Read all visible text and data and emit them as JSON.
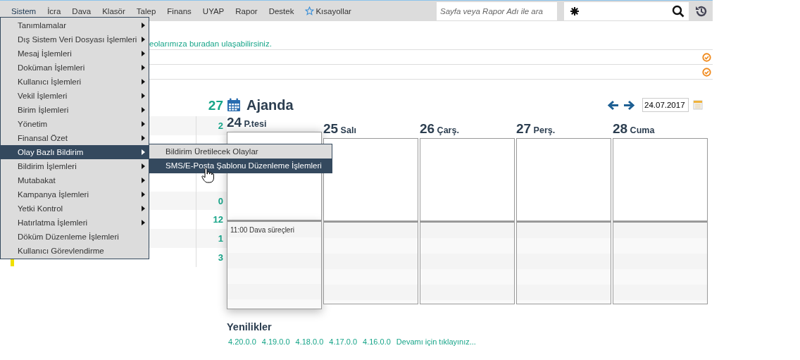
{
  "menubar": {
    "items": [
      {
        "label": "Sistem",
        "selected": true
      },
      {
        "label": "İcra",
        "selected": false
      },
      {
        "label": "Dava",
        "selected": false
      },
      {
        "label": "Klasör",
        "selected": false
      },
      {
        "label": "Talep",
        "selected": false
      },
      {
        "label": "Finans",
        "selected": false
      },
      {
        "label": "UYAP",
        "selected": false
      },
      {
        "label": "Rapor",
        "selected": false
      },
      {
        "label": "Destek",
        "selected": false
      }
    ],
    "shortcuts": "Kısayollar",
    "search": {
      "placeholder": "Sayfa veya Rapor Adı ile ara"
    }
  },
  "notice": "eolarımıza buradan ulaşabilirsiniz.",
  "notice_rows": [
    {
      "done": true
    },
    {
      "done": true
    }
  ],
  "summary": {
    "total": "27",
    "rows": [
      {
        "count": "2"
      },
      {},
      {},
      {},
      {
        "count": "0"
      },
      {
        "count": "12"
      },
      {
        "count": "1"
      },
      {
        "count": "3",
        "color": "#f0e000"
      }
    ]
  },
  "agenda": {
    "title": "Ajanda",
    "date": "24.07.2017",
    "days": [
      {
        "number": "24",
        "name": "P.tesi",
        "raised": true,
        "events": [
          "11:00 Dava süreçleri"
        ]
      },
      {
        "number": "25",
        "name": "Salı",
        "raised": false
      },
      {
        "number": "26",
        "name": "Çarş.",
        "raised": false
      },
      {
        "number": "27",
        "name": "Perş.",
        "raised": false
      },
      {
        "number": "28",
        "name": "Cuma",
        "raised": false
      }
    ]
  },
  "news": {
    "title": "Yenilikler",
    "links": [
      "4.20.0.0",
      "4.19.0.0",
      "4.18.0.0",
      "4.17.0.0",
      "4.16.0.0",
      "Devamı için tıklayınız..."
    ]
  },
  "menu": {
    "items": [
      {
        "label": "Tanımlamalar",
        "submenu": true,
        "selected": false
      },
      {
        "label": "Dış Sistem Veri Dosyası İşlemleri",
        "submenu": true,
        "selected": false
      },
      {
        "label": "Mesaj İşlemleri",
        "submenu": true,
        "selected": false
      },
      {
        "label": "Doküman İşlemleri",
        "submenu": true,
        "selected": false
      },
      {
        "label": "Kullanıcı İşlemleri",
        "submenu": true,
        "selected": false
      },
      {
        "label": "Vekil İşlemleri",
        "submenu": true,
        "selected": false
      },
      {
        "label": "Birim İşlemleri",
        "submenu": true,
        "selected": false
      },
      {
        "label": "Yönetim",
        "submenu": true,
        "selected": false
      },
      {
        "label": "Finansal Özet",
        "submenu": true,
        "selected": false
      },
      {
        "label": "Olay Bazlı Bildirim",
        "submenu": true,
        "selected": true
      },
      {
        "label": "Bildirim İşlemleri",
        "submenu": true,
        "selected": false
      },
      {
        "label": "Mutabakat",
        "submenu": true,
        "selected": false
      },
      {
        "label": "Kampanya İşlemleri",
        "submenu": true,
        "selected": false
      },
      {
        "label": "Yetki Kontrol",
        "submenu": true,
        "selected": false
      },
      {
        "label": "Hatırlatma İşlemleri",
        "submenu": true,
        "selected": false
      },
      {
        "label": "Döküm Düzenleme İşlemleri",
        "submenu": false,
        "selected": false
      },
      {
        "label": "Kullanıcı Görevlendirme",
        "submenu": false,
        "selected": false
      }
    ]
  },
  "submenu": {
    "items": [
      {
        "label": "Bildirim Üretilecek Olaylar",
        "selected": false
      },
      {
        "label": "SMS/E-Posta Şablonu Düzenleme İşlemleri",
        "selected": true
      }
    ]
  }
}
